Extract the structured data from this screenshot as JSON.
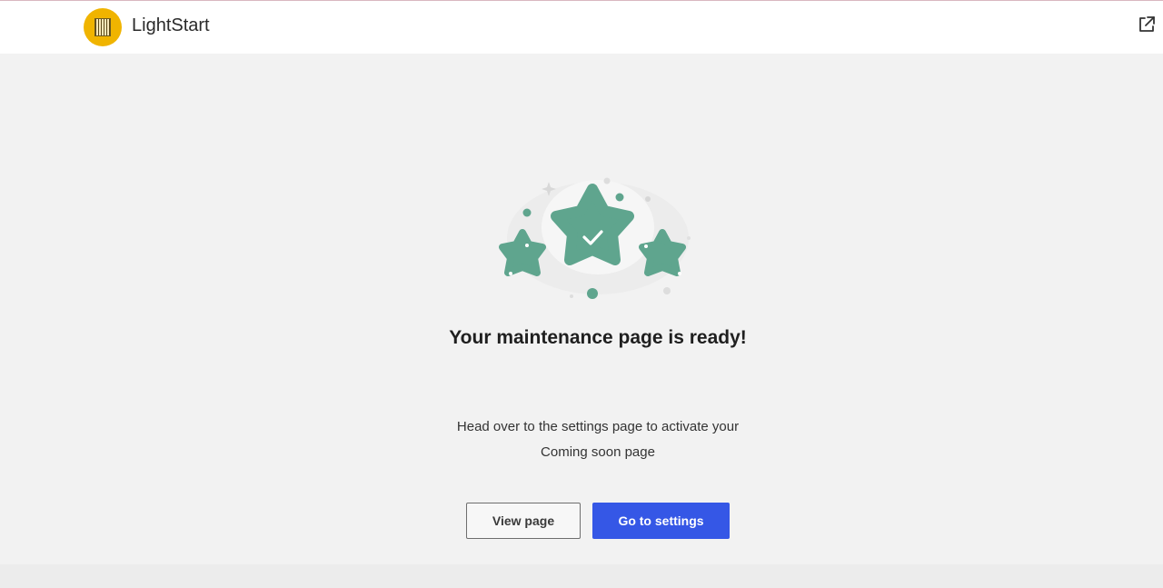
{
  "header": {
    "brand_name": "LightStart",
    "logo_icon": "lightstart-logo-icon",
    "external_link_icon": "external-link-icon"
  },
  "main": {
    "illustration": "three-stars-check-icon",
    "heading": "Your maintenance page is ready!",
    "description_line1": "Head over to the settings page to activate your",
    "description_line2": "Coming soon page",
    "view_page_label": "View page",
    "go_to_settings_label": "Go to settings"
  },
  "colors": {
    "brand": "#f0b400",
    "accent": "#3557e6",
    "star": "#5fa58e"
  }
}
